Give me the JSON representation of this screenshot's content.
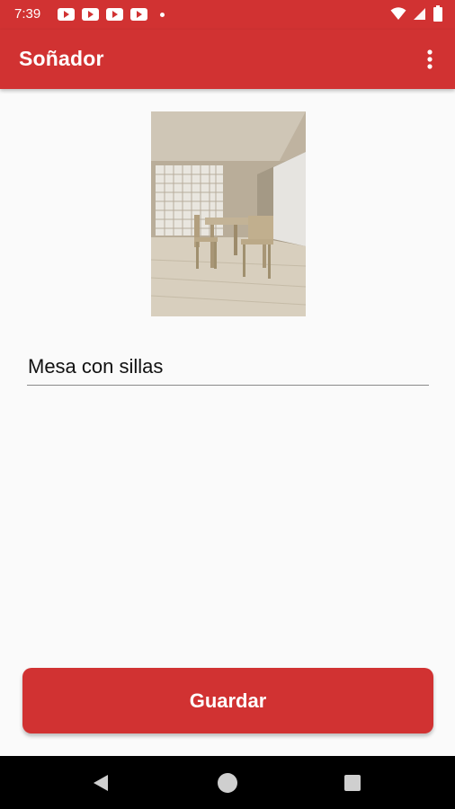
{
  "status_bar": {
    "time": "7:39",
    "notification_icons": [
      "youtube-icon",
      "youtube-icon",
      "youtube-icon",
      "youtube-icon",
      "dot-icon"
    ],
    "system_icons": [
      "wifi-icon",
      "signal-icon",
      "battery-icon"
    ]
  },
  "app_bar": {
    "title": "Soñador",
    "menu_icon": "overflow-menu-icon"
  },
  "content": {
    "image_icon": "dining-room-photo",
    "name_value": "Mesa con sillas"
  },
  "actions": {
    "save_label": "Guardar"
  },
  "nav_bar": {
    "icons": [
      "back-icon",
      "home-icon",
      "recents-icon"
    ]
  },
  "colors": {
    "primary": "#d13232",
    "background": "#fafafa",
    "nav_bar": "#000000"
  }
}
